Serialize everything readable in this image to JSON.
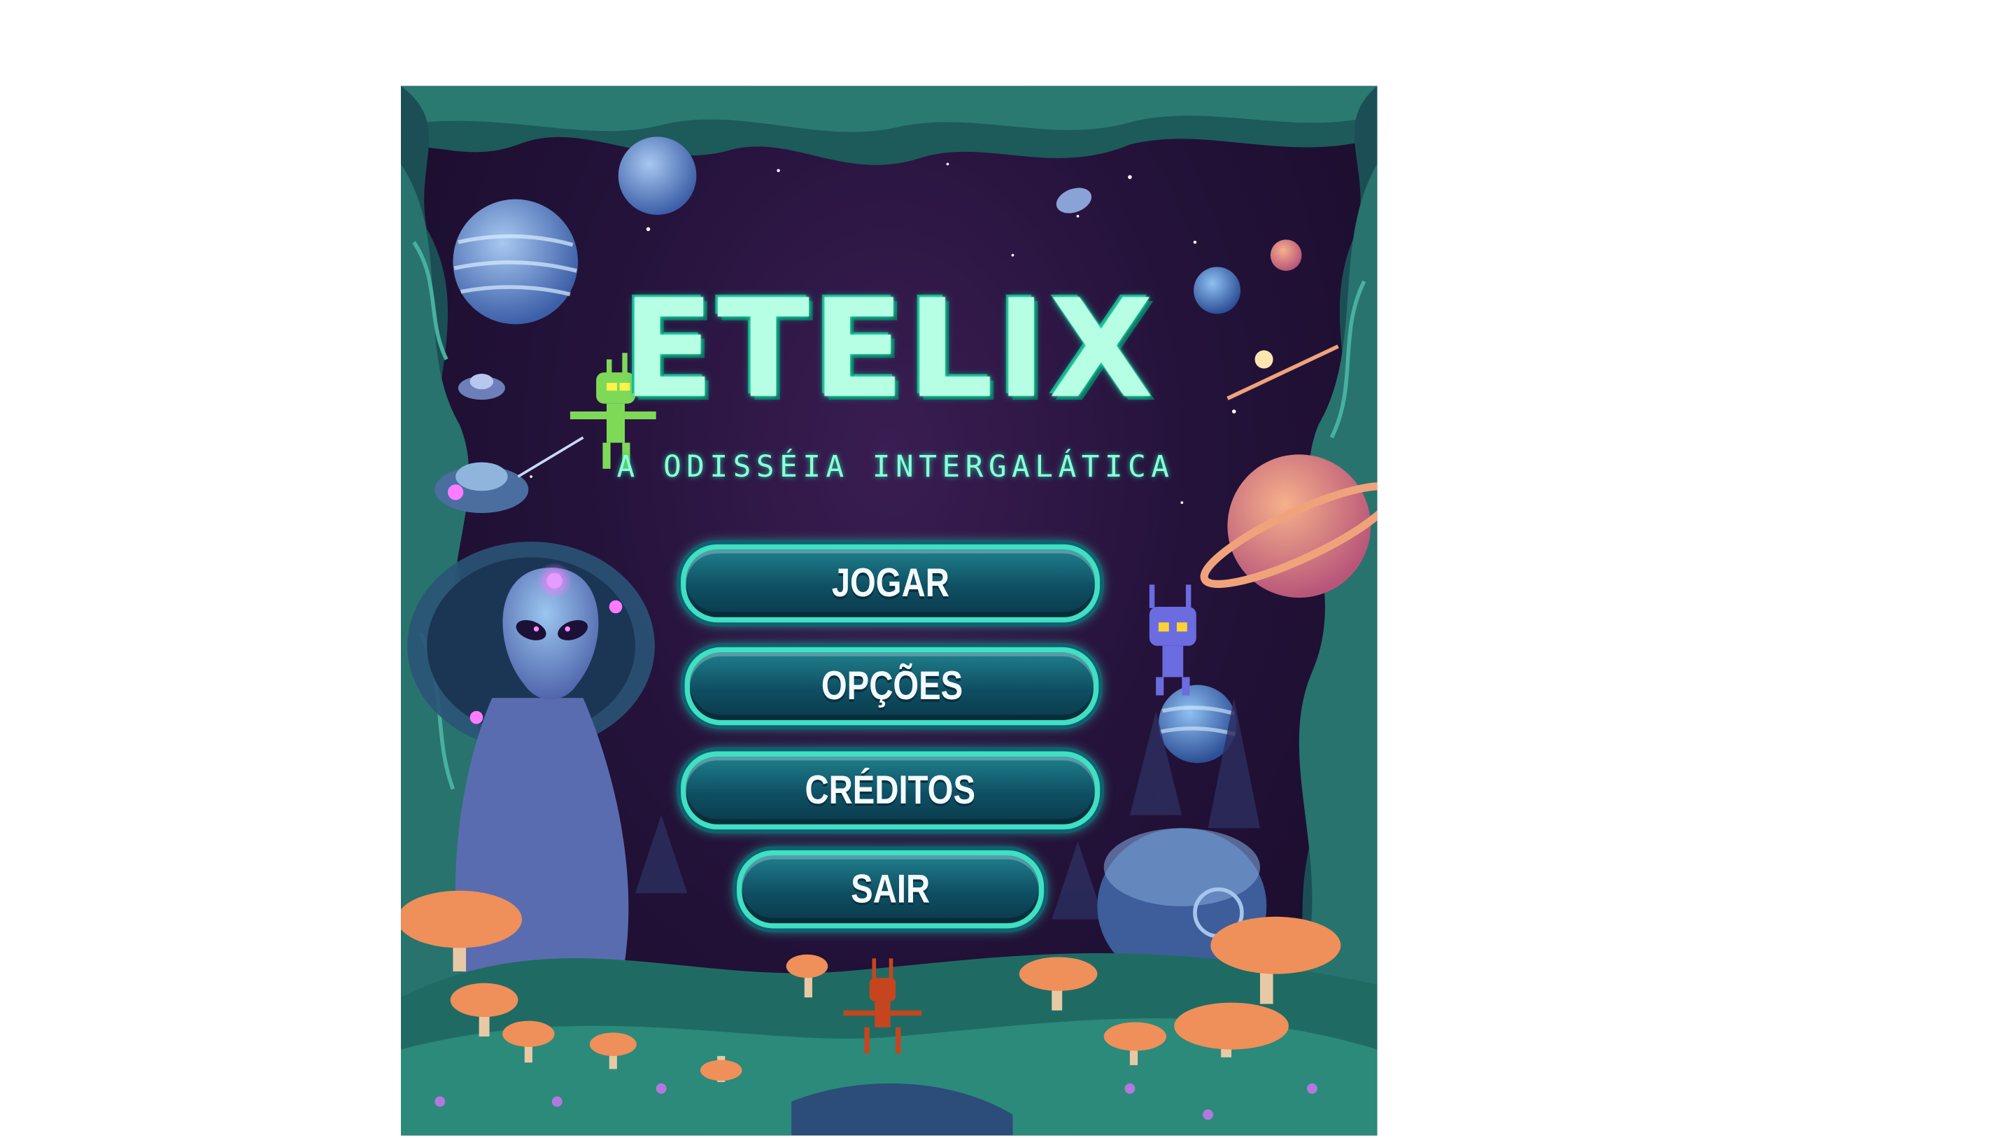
{
  "game": {
    "title": "ETELIX",
    "subtitle": "A ODISSÉIA INTERGALÁTICA"
  },
  "menu": {
    "play_label": "JOGAR",
    "options_label": "OPÇÕES",
    "credits_label": "CRÉDITOS",
    "exit_label": "SAIR"
  },
  "colors": {
    "title": "#b6ffe4",
    "button_border": "#3fe0c3",
    "button_fill": "#0f4f63",
    "background": "#24123a"
  }
}
